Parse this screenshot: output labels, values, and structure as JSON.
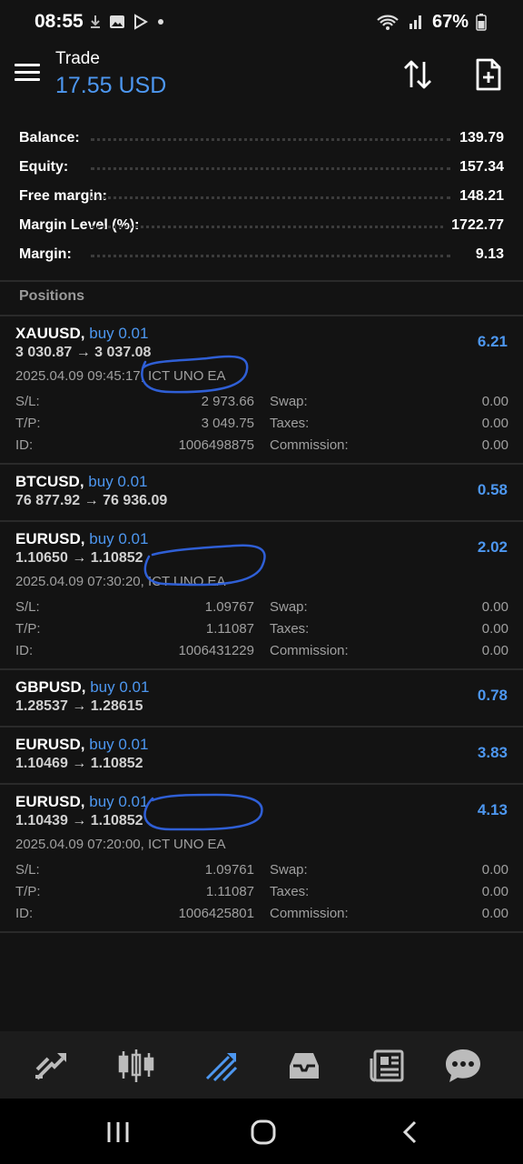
{
  "status_bar": {
    "time": "08:55",
    "battery": "67%"
  },
  "header": {
    "title": "Trade",
    "subtitle": "17.55 USD"
  },
  "summary": [
    {
      "label": "Balance:",
      "value": "139.79"
    },
    {
      "label": "Equity:",
      "value": "157.34"
    },
    {
      "label": "Free margin:",
      "value": "148.21"
    },
    {
      "label": "Margin Level (%):",
      "value": "1722.77"
    },
    {
      "label": "Margin:",
      "value": "9.13"
    }
  ],
  "positions_header": "Positions",
  "positions": [
    {
      "symbol": "XAUUSD,",
      "side": "buy 0.01",
      "prices": "3 030.87 → 3 037.08",
      "profit": "6.21",
      "meta": "2025.04.09 09:45:17, ICT UNO EA",
      "sl_label": "S/L:",
      "sl": "2 973.66",
      "swap_label": "Swap:",
      "swap": "0.00",
      "tp_label": "T/P:",
      "tp": "3 049.75",
      "taxes_label": "Taxes:",
      "taxes": "0.00",
      "id_label": "ID:",
      "id": "1006498875",
      "comm_label": "Commission:",
      "comm": "0.00"
    },
    {
      "symbol": "BTCUSD,",
      "side": "buy 0.01",
      "prices": "76 877.92 → 76 936.09",
      "profit": "0.58"
    },
    {
      "symbol": "EURUSD,",
      "side": "buy 0.01",
      "prices": "1.10650 → 1.10852",
      "profit": "2.02",
      "meta": "2025.04.09 07:30:20, ICT UNO EA",
      "sl_label": "S/L:",
      "sl": "1.09767",
      "swap_label": "Swap:",
      "swap": "0.00",
      "tp_label": "T/P:",
      "tp": "1.11087",
      "taxes_label": "Taxes:",
      "taxes": "0.00",
      "id_label": "ID:",
      "id": "1006431229",
      "comm_label": "Commission:",
      "comm": "0.00"
    },
    {
      "symbol": "GBPUSD,",
      "side": "buy 0.01",
      "prices": "1.28537 → 1.28615",
      "profit": "0.78"
    },
    {
      "symbol": "EURUSD,",
      "side": "buy 0.01",
      "prices": "1.10469 → 1.10852",
      "profit": "3.83"
    },
    {
      "symbol": "EURUSD,",
      "side": "buy 0.01",
      "prices": "1.10439 → 1.10852",
      "profit": "4.13",
      "meta": "2025.04.09 07:20:00, ICT UNO EA",
      "sl_label": "S/L:",
      "sl": "1.09761",
      "swap_label": "Swap:",
      "swap": "0.00",
      "tp_label": "T/P:",
      "tp": "1.11087",
      "taxes_label": "Taxes:",
      "taxes": "0.00",
      "id_label": "ID:",
      "id": "1006425801",
      "comm_label": "Commission:",
      "comm": "0.00"
    }
  ],
  "bottom_nav": [
    {
      "icon": "quotes-icon"
    },
    {
      "icon": "chart-icon"
    },
    {
      "icon": "trade-icon",
      "active": true
    },
    {
      "icon": "history-icon"
    },
    {
      "icon": "news-icon"
    },
    {
      "icon": "chat-icon"
    }
  ],
  "colors": {
    "accent": "#4d97f0",
    "background": "#131313",
    "scribble": "#2f5fd6"
  }
}
